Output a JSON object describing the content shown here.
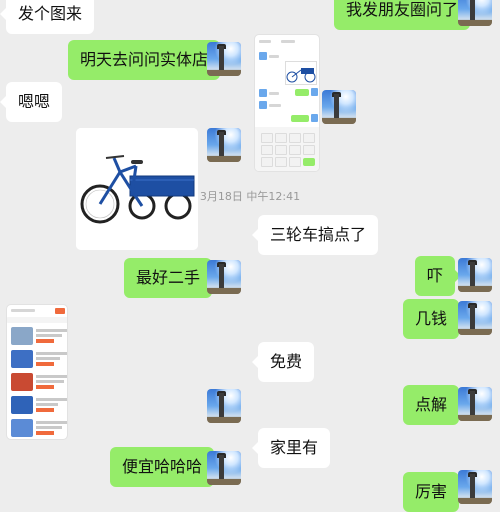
{
  "messages": {
    "m1": "发个图来",
    "m2": "我发朋友圈问了",
    "m3": "明天去问问实体店",
    "m4": "嗯嗯",
    "m5": "三轮车搞点了",
    "m6": "最好二手",
    "m7": "吓",
    "m8": "几钱",
    "m9": "免费",
    "m10": "点解",
    "m11": "家里有",
    "m12": "便宜哈哈哈",
    "m13": "厉害"
  },
  "timestamp": "3月18日 中午12:41",
  "colors": {
    "outgoing_bubble": "#95ec69",
    "incoming_bubble": "#ffffff",
    "background": "#ededed",
    "tricycle": "#1e4fa3"
  },
  "icons": {
    "avatar": "sky-tower-avatar-photo",
    "bike_image": "blue-tricycle-photo"
  }
}
